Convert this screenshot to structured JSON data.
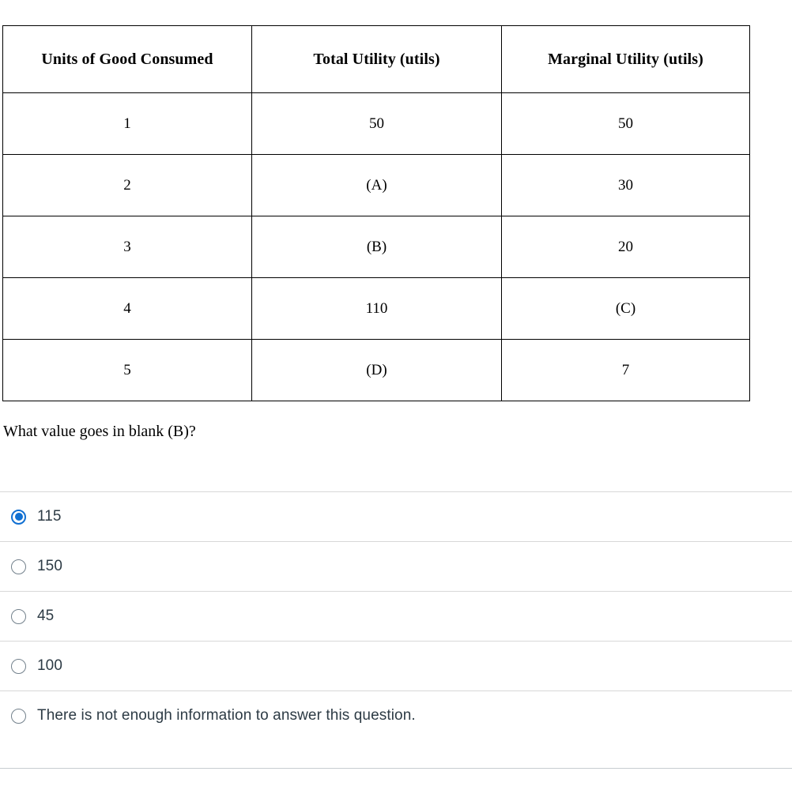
{
  "table": {
    "name": "utility-table",
    "headers": [
      "Units of Good Consumed",
      "Total Utility (utils)",
      "Marginal Utility (utils)"
    ],
    "rows": [
      [
        "1",
        "50",
        "50"
      ],
      [
        "2",
        "(A)",
        "30"
      ],
      [
        "3",
        "(B)",
        "20"
      ],
      [
        "4",
        "110",
        "(C)"
      ],
      [
        "5",
        "(D)",
        "7"
      ]
    ]
  },
  "question": {
    "prompt": "What value goes in blank (B)?"
  },
  "answers": {
    "selected_index": 0,
    "options": [
      {
        "label": "115",
        "selected": true
      },
      {
        "label": "150",
        "selected": false
      },
      {
        "label": "45",
        "selected": false
      },
      {
        "label": "100",
        "selected": false
      },
      {
        "label": "There is not enough information to answer this question.",
        "selected": false
      }
    ]
  },
  "colors": {
    "accent_blue": "#1170d2",
    "radio_outline": "#73818c",
    "text": "#2d3b45",
    "table_border": "#000000",
    "row_divider": "#d8d8d8",
    "bottom_rule": "#c7cdd1"
  }
}
